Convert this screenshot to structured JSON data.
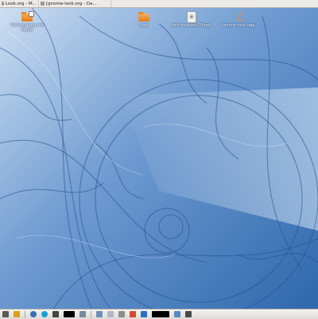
{
  "taskbar": {
    "tasks": [
      {
        "label": "Look.org - M...",
        "icon": "browser-icon"
      },
      {
        "label": "[gnome-look.org - Da...",
        "icon": "browser-icon"
      }
    ]
  },
  "desktop": {
    "icons": [
      {
        "label": "Verknüpfung mit Musik",
        "icon": "folder-link-icon"
      },
      {
        "label": "Logs",
        "icon": "folder-icon"
      },
      {
        "label": "cafe-podcast.00ogg",
        "icon": "disc-file-icon"
      },
      {
        "label": "gnome-look.ogg",
        "icon": "music-note-icon"
      }
    ]
  },
  "panel": {
    "items": [
      "show-desktop-icon",
      "pager-icon",
      "browser-icon",
      "skype-icon",
      "terminal-icon",
      "redacted-launcher",
      "tray-generic-icon",
      "network-icon",
      "people-icon",
      "trash-icon",
      "updates-icon",
      "bluetooth-icon",
      "redacted-clock",
      "calendar-icon",
      "volume-icon"
    ]
  },
  "colors": {
    "accent": "#2a62a6",
    "panel": "#e8e7e4",
    "folder": "#e87f22"
  }
}
